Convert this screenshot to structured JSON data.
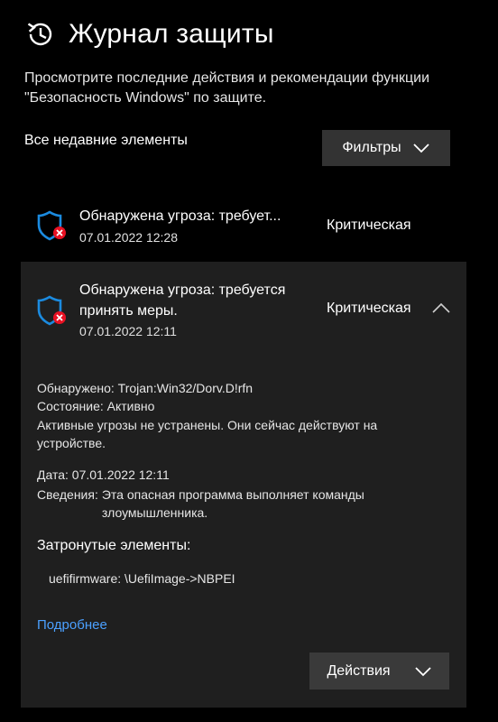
{
  "header": {
    "title": "Журнал защиты",
    "icon": "history-icon"
  },
  "intro": "Просмотрите последние действия и рекомендации функции \"Безопасность Windows\" по защите.",
  "list": {
    "label": "Все недавние элементы",
    "filter_label": "Фильтры"
  },
  "items": [
    {
      "title": "Обнаружена угроза: требует...",
      "date": "07.01.2022 12:28",
      "severity": "Критическая",
      "icon": "shield-threat-icon"
    },
    {
      "title": "Обнаружена угроза: требуется принять меры.",
      "date": "07.01.2022 12:11",
      "severity": "Критическая",
      "icon": "shield-threat-icon",
      "details": {
        "detected_key": "Обнаружено:",
        "detected_val": "Trojan:Win32/Dorv.D!rfn",
        "status_key": "Состояние:",
        "status_val": "Активно",
        "status_note": "Активные угрозы не устранены. Они сейчас действуют на устройстве.",
        "date_key": "Дата:",
        "date_val": "07.01.2022 12:11",
        "info_key": "Сведения:",
        "info_val": "Эта опасная программа выполняет команды злоумышленника.",
        "affected_title": "Затронутые элементы:",
        "affected_item": "uefifirmware: \\UefiImage->NBPEI",
        "more_link": "Подробнее",
        "actions_label": "Действия"
      }
    }
  ],
  "colors": {
    "background": "#000000",
    "panel": "#1f1f1f",
    "button": "#333333",
    "link": "#4ba0ff",
    "shield_blue": "#1b8be0",
    "threat_red": "#e81123"
  }
}
